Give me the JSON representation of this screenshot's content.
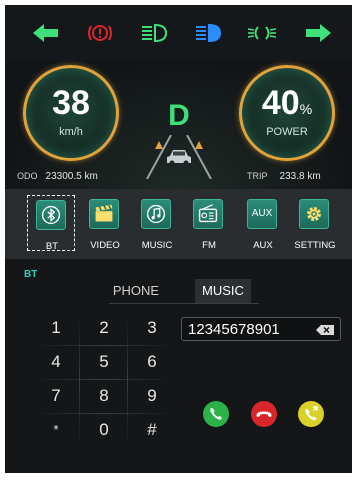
{
  "colors": {
    "accent_green": "#3ee07a",
    "warning_red": "#d8262b",
    "low_beam_blue": "#2a8cff",
    "gauge_ring_gold": "#e0a33a",
    "teal_button": "#2a8c78",
    "call_green": "#2db24a",
    "hangup_red": "#d8262b",
    "transfer_yellow": "#d9d12a"
  },
  "top_bar": {
    "icons": [
      {
        "name": "left-turn-arrow-icon",
        "color": "#3ee07a"
      },
      {
        "name": "brake-warning-icon",
        "color": "#d8262b"
      },
      {
        "name": "high-beam-icon",
        "color": "#3ee07a"
      },
      {
        "name": "low-beam-icon",
        "color": "#2a8cff"
      },
      {
        "name": "position-lights-icon",
        "color": "#3ee07a"
      },
      {
        "name": "right-turn-arrow-icon",
        "color": "#3ee07a"
      }
    ]
  },
  "dashboard": {
    "speed_value": "38",
    "speed_unit": "km/h",
    "gear": "D",
    "power_value": "40",
    "power_symbol": "%",
    "power_label": "POWER",
    "odo_label": "ODO",
    "odo_value": "23300.5 km",
    "trip_label": "TRIP",
    "trip_value": "233.8 km"
  },
  "sources": {
    "selected": "BT",
    "items": [
      {
        "label": "BT",
        "icon": "bluetooth-icon"
      },
      {
        "label": "VIDEO",
        "icon": "clapperboard-icon"
      },
      {
        "label": "MUSIC",
        "icon": "music-note-icon"
      },
      {
        "label": "FM",
        "icon": "radio-icon"
      },
      {
        "label": "AUX",
        "icon_text": "AUX"
      },
      {
        "label": "SETTING",
        "icon": "gear-icon"
      }
    ]
  },
  "bt_panel": {
    "title": "BT",
    "tabs": [
      "PHONE",
      "MUSIC"
    ],
    "active_tab": "MUSIC",
    "dial_number": "12345678901",
    "keypad": [
      "1",
      "2",
      "3",
      "4",
      "5",
      "6",
      "7",
      "8",
      "9",
      "*",
      "0",
      "#"
    ],
    "call_buttons": [
      "phone-call-icon",
      "phone-hangup-icon",
      "phone-transfer-icon"
    ]
  }
}
